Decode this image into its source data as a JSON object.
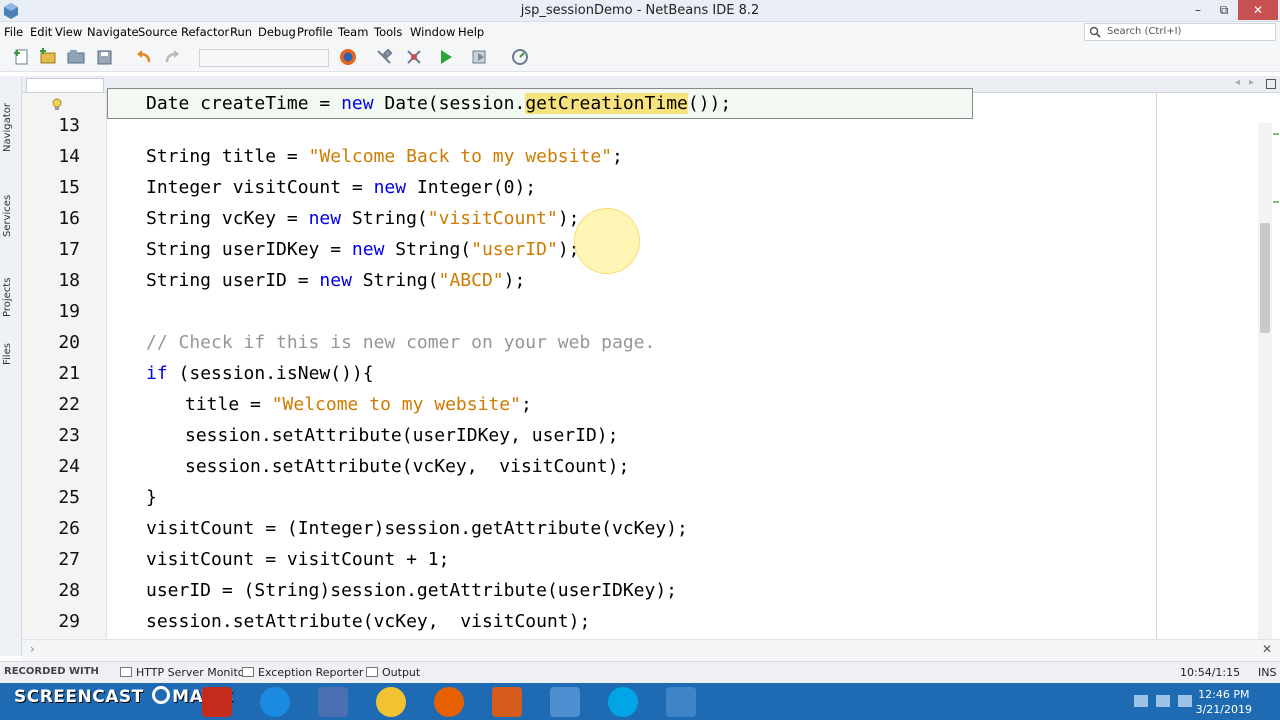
{
  "window": {
    "title": "jsp_sessionDemo - NetBeans IDE 8.2",
    "minimize": "–",
    "maximize": "⧉",
    "close": "✕"
  },
  "menu": [
    "File",
    "Edit",
    "View",
    "Navigate",
    "Source",
    "Refactor",
    "Run",
    "Debug",
    "Profile",
    "Team",
    "Tools",
    "Window",
    "Help"
  ],
  "search": {
    "placeholder": "Search (Ctrl+I)"
  },
  "side_tabs": [
    "Navigator",
    "Services",
    "Projects",
    "Files"
  ],
  "editor": {
    "sticky_line": {
      "parts": [
        {
          "t": "Date createTime = ",
          "c": ""
        },
        {
          "t": "new",
          "c": "kw"
        },
        {
          "t": " Date(session.",
          "c": ""
        },
        {
          "t": "getCreationTime",
          "c": "hl"
        },
        {
          "t": "());",
          "c": ""
        }
      ]
    },
    "lines": [
      {
        "num": "13",
        "indent": 0,
        "parts": []
      },
      {
        "num": "14",
        "indent": 0,
        "parts": [
          {
            "t": "String title = ",
            "c": ""
          },
          {
            "t": "\"Welcome Back to my website\"",
            "c": "str"
          },
          {
            "t": ";",
            "c": ""
          }
        ]
      },
      {
        "num": "15",
        "indent": 0,
        "parts": [
          {
            "t": "Integer visitCount = ",
            "c": ""
          },
          {
            "t": "new",
            "c": "kw"
          },
          {
            "t": " Integer(0);",
            "c": ""
          }
        ]
      },
      {
        "num": "16",
        "indent": 0,
        "parts": [
          {
            "t": "String vcKey = ",
            "c": ""
          },
          {
            "t": "new",
            "c": "kw"
          },
          {
            "t": " String(",
            "c": ""
          },
          {
            "t": "\"visitCount\"",
            "c": "str"
          },
          {
            "t": ");",
            "c": ""
          }
        ]
      },
      {
        "num": "17",
        "indent": 0,
        "parts": [
          {
            "t": "String userIDKey = ",
            "c": ""
          },
          {
            "t": "new",
            "c": "kw"
          },
          {
            "t": " String(",
            "c": ""
          },
          {
            "t": "\"userID\"",
            "c": "str"
          },
          {
            "t": ");",
            "c": ""
          }
        ]
      },
      {
        "num": "18",
        "indent": 0,
        "parts": [
          {
            "t": "String userID = ",
            "c": ""
          },
          {
            "t": "new",
            "c": "kw"
          },
          {
            "t": " String(",
            "c": ""
          },
          {
            "t": "\"ABCD\"",
            "c": "str"
          },
          {
            "t": ");",
            "c": ""
          }
        ]
      },
      {
        "num": "19",
        "indent": 0,
        "parts": []
      },
      {
        "num": "20",
        "indent": 0,
        "parts": [
          {
            "t": "// Check if this is new comer on your web page.",
            "c": "cmt"
          }
        ]
      },
      {
        "num": "21",
        "indent": 0,
        "parts": [
          {
            "t": "if",
            "c": "kw"
          },
          {
            "t": " (session.isNew()){",
            "c": ""
          }
        ]
      },
      {
        "num": "22",
        "indent": 1,
        "parts": [
          {
            "t": "title = ",
            "c": ""
          },
          {
            "t": "\"Welcome to my website\"",
            "c": "str"
          },
          {
            "t": ";",
            "c": ""
          }
        ]
      },
      {
        "num": "23",
        "indent": 1,
        "parts": [
          {
            "t": "session.setAttribute(userIDKey, userID);",
            "c": ""
          }
        ]
      },
      {
        "num": "24",
        "indent": 1,
        "parts": [
          {
            "t": "session.setAttribute(vcKey,  visitCount);",
            "c": ""
          }
        ]
      },
      {
        "num": "25",
        "indent": 0,
        "parts": [
          {
            "t": "}",
            "c": ""
          }
        ]
      },
      {
        "num": "26",
        "indent": 0,
        "parts": [
          {
            "t": "visitCount = (Integer)session.getAttribute(vcKey);",
            "c": ""
          }
        ]
      },
      {
        "num": "27",
        "indent": 0,
        "parts": [
          {
            "t": "visitCount = visitCount + 1;",
            "c": ""
          }
        ]
      },
      {
        "num": "28",
        "indent": 0,
        "parts": [
          {
            "t": "userID = (String)session.getAttribute(userIDKey);",
            "c": ""
          }
        ]
      },
      {
        "num": "29",
        "indent": 0,
        "parts": [
          {
            "t": "session.setAttribute(vcKey,  visitCount);",
            "c": ""
          }
        ]
      }
    ]
  },
  "status_tabs": {
    "recorded": "RECORDED WITH",
    "http": "HTTP Server Monitor",
    "exception": "Exception Reporter",
    "output": "Output",
    "position": "10:54/1:15",
    "mode": "INS"
  },
  "taskbar": {
    "brand": "SCREENCAST",
    "brand_suffix": "MATIC",
    "time": "12:46 PM",
    "date": "3/21/2019"
  },
  "colors": {
    "keyword": "#0000e6",
    "string": "#ce7b00",
    "comment": "#969696",
    "highlight": "#f7e27e",
    "taskbar": "#1e6bb4"
  }
}
